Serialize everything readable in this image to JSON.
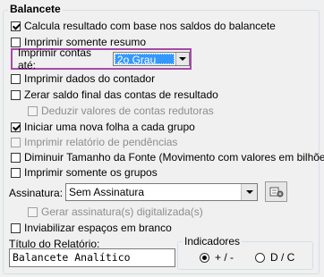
{
  "group_title": "Balancete",
  "options": {
    "calcula": {
      "label": "Calcula resultado com base nos saldos do balancete",
      "checked": true
    },
    "resumo": {
      "label": "Imprimir somente resumo",
      "checked": false
    },
    "contas_ate": {
      "label": "Imprimir contas até:",
      "value": "2o Grau"
    },
    "dados_contador": {
      "label": "Imprimir dados do contador",
      "checked": false
    },
    "zerar_saldo": {
      "label": "Zerar saldo final das contas de resultado",
      "checked": false
    },
    "deduzir": {
      "label": "Deduzir valores de contas redutoras",
      "checked": false,
      "disabled": true
    },
    "nova_folha": {
      "label": "Iniciar uma nova folha a cada grupo",
      "checked": true
    },
    "pendencias": {
      "label": "Imprimir relatório de pendências",
      "checked": false,
      "disabled": true
    },
    "diminuir_fonte": {
      "label": "Diminuir Tamanho da Fonte (Movimento com valores em bilhões)",
      "checked": false
    },
    "somente_grupos": {
      "label": "Imprimir somente os grupos",
      "checked": false
    }
  },
  "assinatura": {
    "label": "Assinatura:",
    "value": "Sem Assinatura",
    "button_icon": "signature-settings-icon"
  },
  "gerar_assinatura": {
    "label": "Gerar assinatura(s) digitalizada(s)",
    "checked": false,
    "disabled": true
  },
  "inviabilizar": {
    "label": "Inviabilizar espaços em branco",
    "checked": false
  },
  "titulo": {
    "label": "Título do Relatório:",
    "value": "Balancete Analítico"
  },
  "indicadores": {
    "title": "Indicadores",
    "options": [
      {
        "label": "+ / -",
        "selected": true
      },
      {
        "label": "D / C",
        "selected": false
      }
    ]
  },
  "colors": {
    "highlight_box": "#a64aa6",
    "selection": "#3399ff"
  }
}
